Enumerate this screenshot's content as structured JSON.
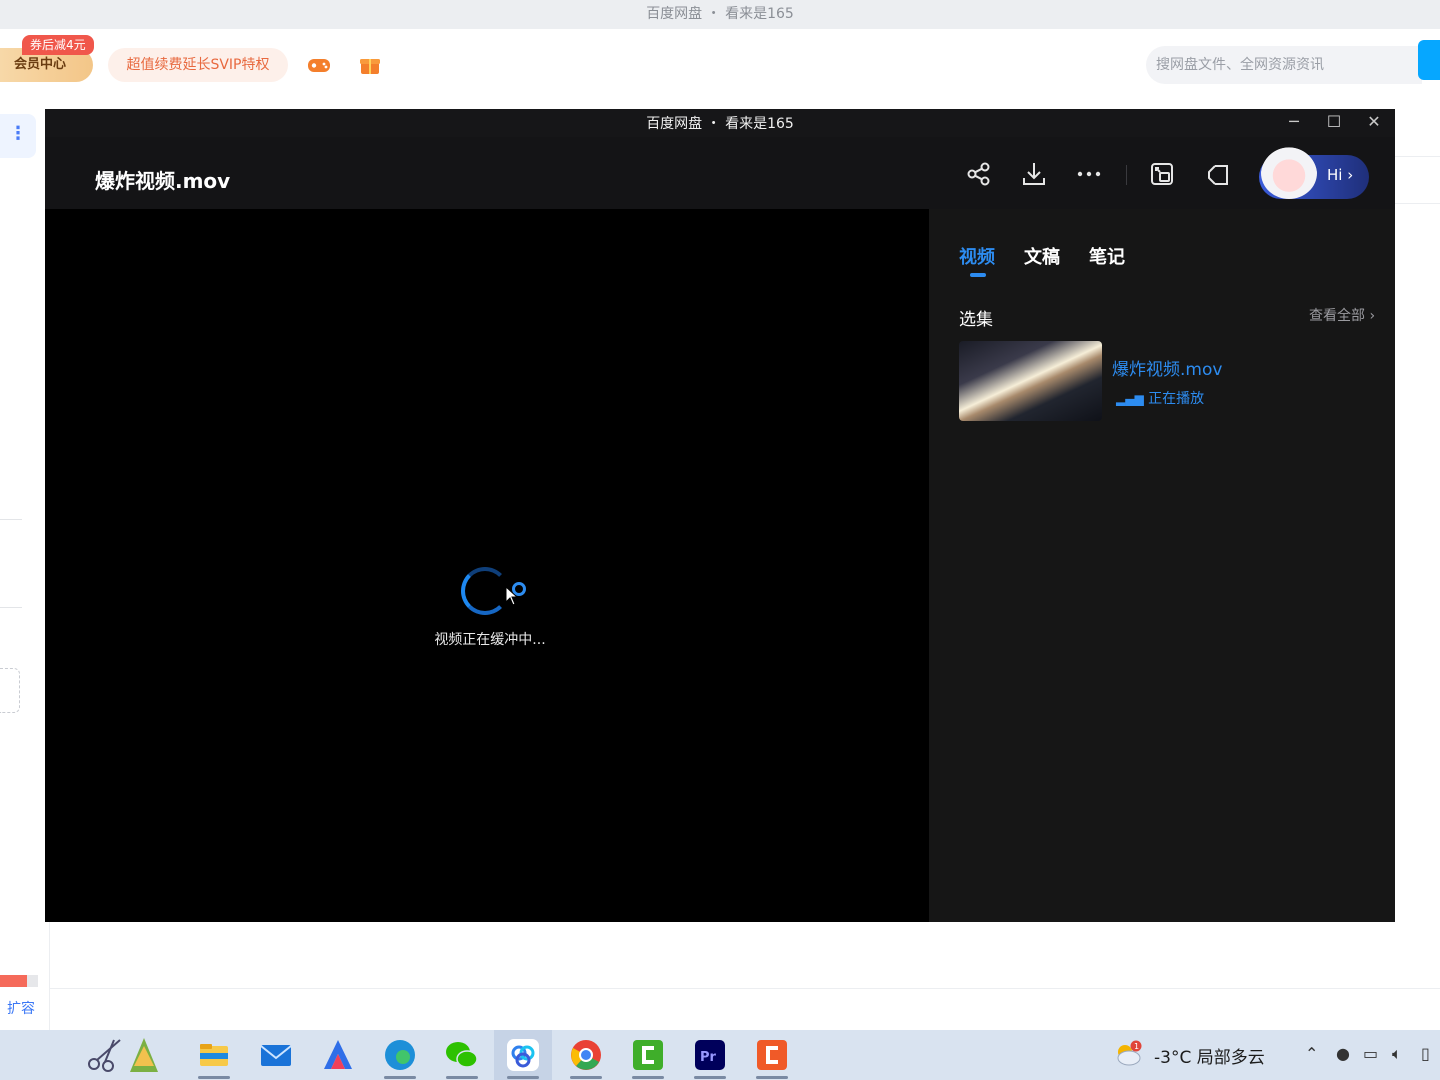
{
  "background_app": {
    "title": "百度网盘 ・ 看来是165",
    "member_center": "会员中心",
    "coupon_badge": "券后减4元",
    "renew_promo": "超值续费延长SVIP特权",
    "search_placeholder": "搜网盘文件、全网资源资讯",
    "left_menu_glyph": "⋮",
    "expand_link": "扩容",
    "storage_used_fraction": 0.7
  },
  "player": {
    "window_title": "百度网盘 ・ 看来是165",
    "file_title": "爆炸视频.mov",
    "hi_label": "Hi ›",
    "buffering_text": "视频正在缓冲中...",
    "tabs": [
      {
        "label": "视频",
        "active": true
      },
      {
        "label": "文稿",
        "active": false
      },
      {
        "label": "笔记",
        "active": false
      }
    ],
    "playlist": {
      "title": "选集",
      "view_all": "查看全部",
      "items": [
        {
          "name": "爆炸视频.mov",
          "status": "正在播放"
        }
      ]
    },
    "header_icons": [
      "share-icon",
      "download-icon",
      "more-icon",
      "picture-in-picture-icon",
      "crop-icon"
    ],
    "accent_color": "#2d8cf0"
  },
  "taskbar": {
    "apps": [
      "scissors-tree-icon",
      "file-explorer-icon",
      "mail-icon",
      "app-a-icon",
      "edge-icon",
      "wechat-icon",
      "baidu-netdisk-icon",
      "chrome-icon",
      "camtasia-green-icon",
      "premiere-pro-icon",
      "camtasia-orange-icon"
    ],
    "weather": "-3°C 局部多云",
    "weather_badge": "1"
  }
}
